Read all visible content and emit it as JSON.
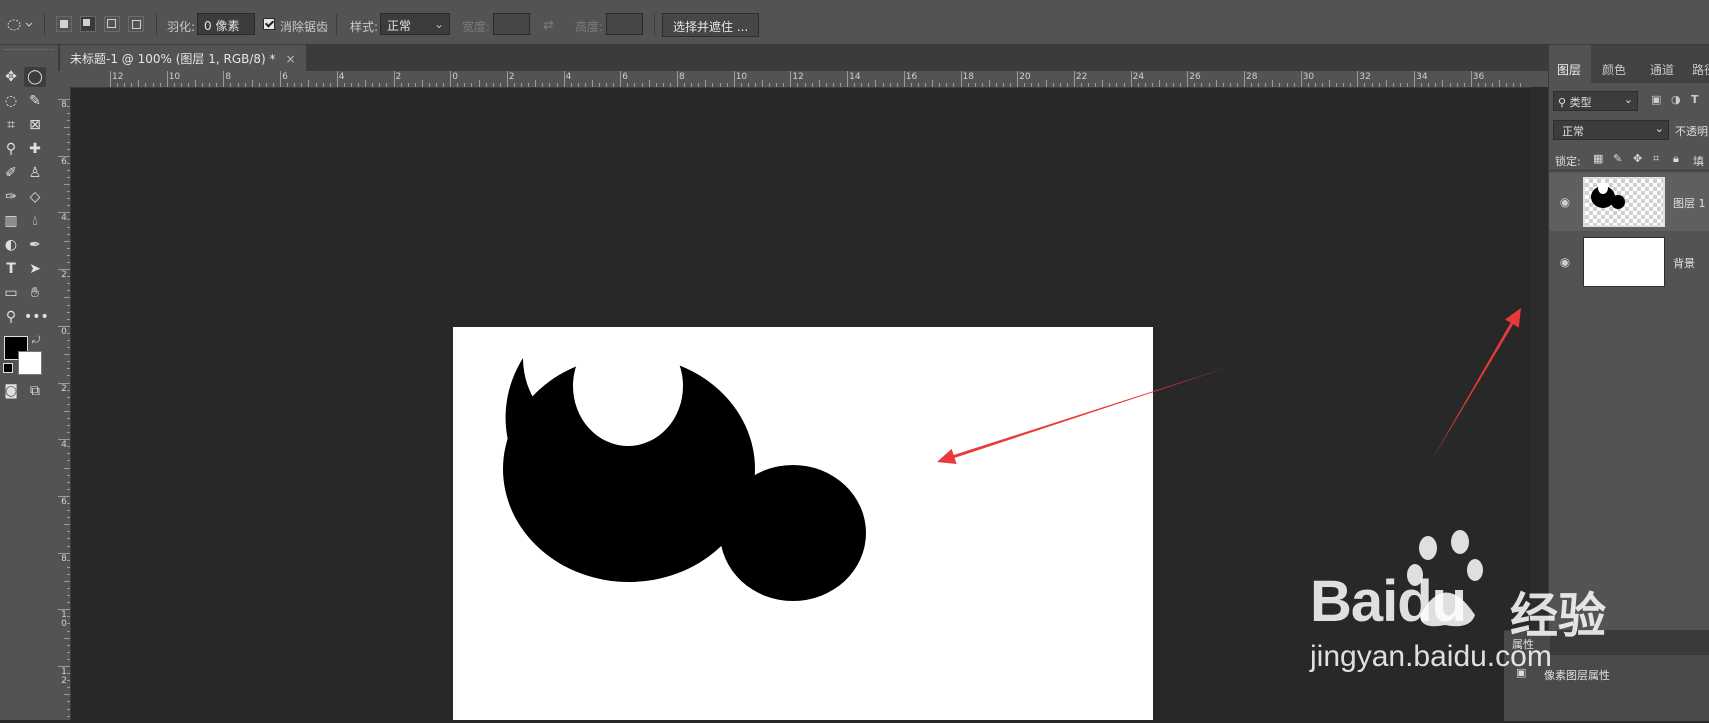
{
  "options_bar": {
    "feather_label": "羽化:",
    "feather_value": "0 像素",
    "antialias_label": "消除锯齿",
    "style_label": "样式:",
    "style_value": "正常",
    "width_label": "宽度:",
    "height_label": "高度:",
    "select_mask_button": "选择并遮住 ..."
  },
  "document_tab": {
    "title": "未标题-1 @ 100% (图层 1, RGB/8) *",
    "close": "×"
  },
  "rulers": {
    "horizontal_labels": [
      "12",
      "10",
      "8",
      "6",
      "4",
      "2",
      "0",
      "2",
      "4",
      "6",
      "8",
      "10",
      "12",
      "14",
      "16",
      "18",
      "20",
      "22",
      "24",
      "26",
      "28",
      "30",
      "32",
      "34",
      "36"
    ],
    "vertical_labels": [
      "8",
      "6",
      "4",
      "2",
      "0",
      "2",
      "4",
      "6",
      "8",
      "1\n0",
      "1\n2"
    ]
  },
  "panel": {
    "tabs": [
      "图层",
      "颜色",
      "通道",
      "路径"
    ],
    "filter_value": "类型",
    "blend_mode": "正常",
    "opacity_label": "不透明",
    "lock_label": "锁定:",
    "fill_label": "填",
    "layers": [
      {
        "name": "图层 1",
        "selected": true
      },
      {
        "name": "背景",
        "selected": false
      }
    ]
  },
  "properties": {
    "tab_label": "属性",
    "row_label": "像素图层属性"
  },
  "watermark": {
    "brand": "Baidu",
    "suffix": "经验",
    "url": "jingyan.baidu.com"
  },
  "colors": {
    "arrow": "#e83a3a",
    "ui_bg": "#535353",
    "workspace": "#282828"
  }
}
